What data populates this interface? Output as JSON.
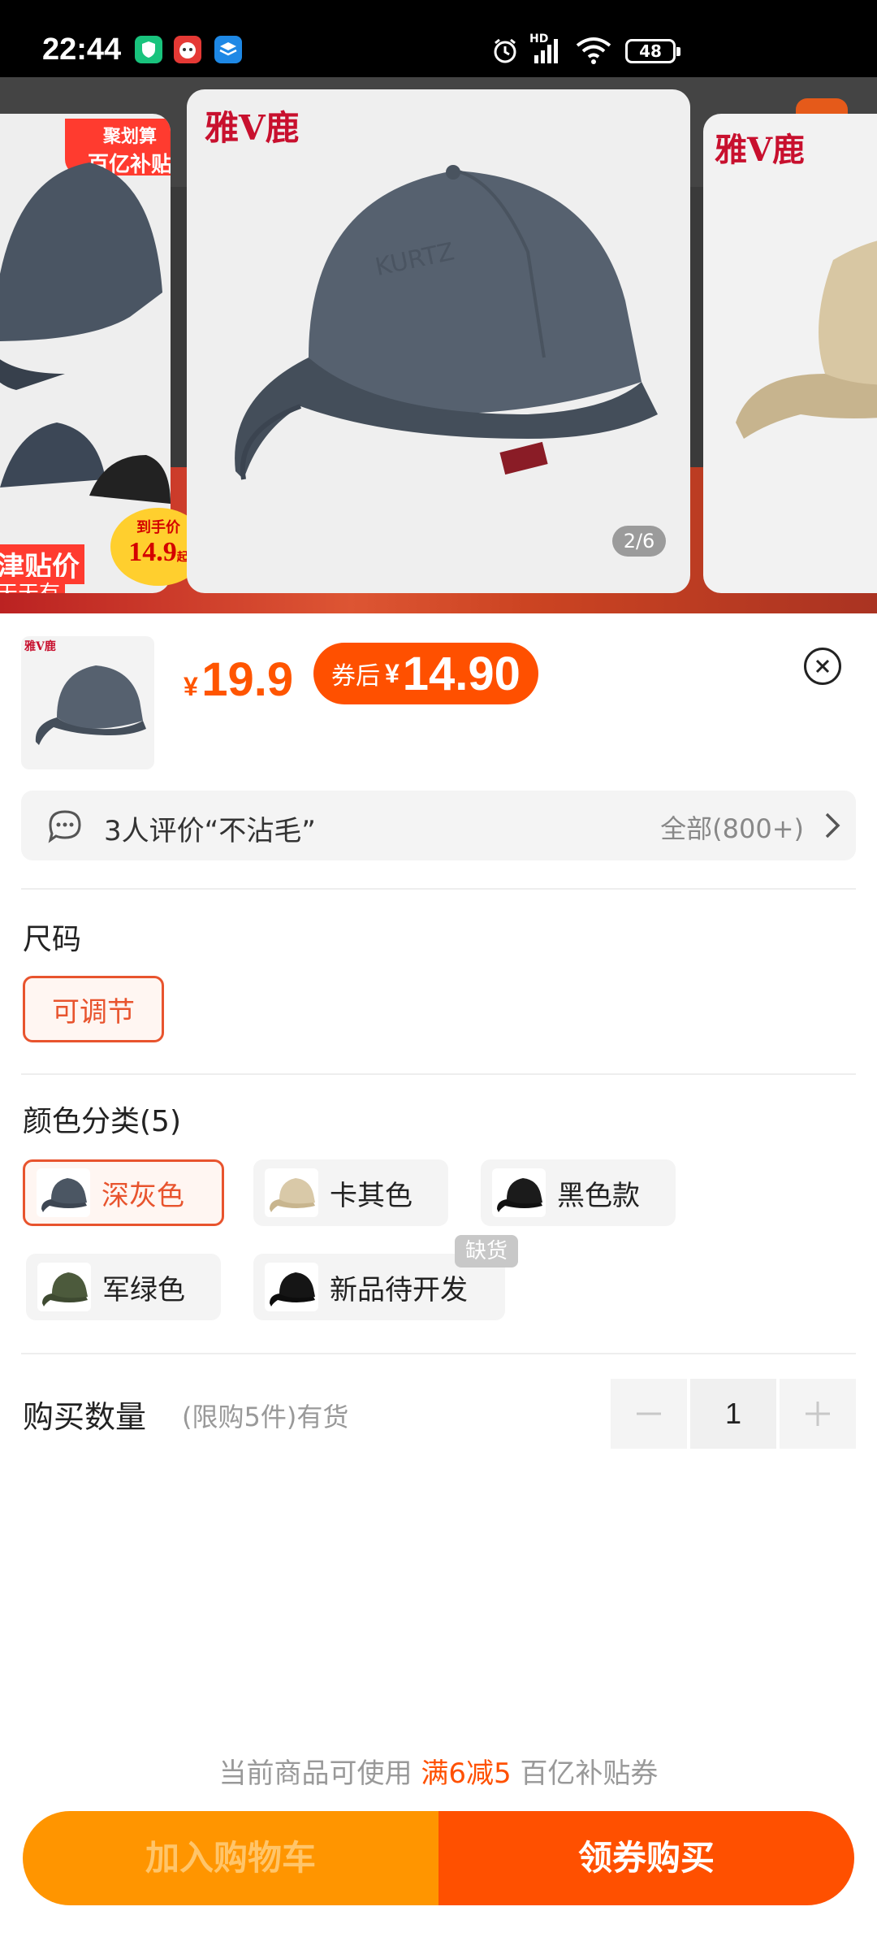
{
  "status_bar": {
    "time": "22:44",
    "signal_label": "HD",
    "battery": "48"
  },
  "gallery": {
    "left_card": {
      "banner_line1": "聚划算",
      "banner_line2": "百亿补贴",
      "price_tag": "到手价",
      "price": "14.9",
      "price_suffix": "起",
      "side_text1": "津贴价",
      "side_text2": "天天有"
    },
    "brand": "雅V鹿",
    "page_indicator": "2/6"
  },
  "sheet": {
    "price": {
      "currency": "¥",
      "value": "19.9"
    },
    "coupon_price": {
      "label": "券后",
      "currency": "¥",
      "value": "14.90"
    },
    "review": {
      "text": "3人评价“不沾毛”",
      "all": "全部(800+)"
    },
    "size": {
      "title": "尺码",
      "options": [
        "可调节"
      ]
    },
    "color": {
      "title": "颜色分类(5)",
      "options": [
        {
          "label": "深灰色",
          "selected": true,
          "cap_color": "#4b5663"
        },
        {
          "label": "卡其色",
          "selected": false,
          "cap_color": "#d9c9a8"
        },
        {
          "label": "黑色款",
          "selected": false,
          "cap_color": "#1b1b1b"
        },
        {
          "label": "军绿色",
          "selected": false,
          "cap_color": "#4c5a3c"
        },
        {
          "label": "新品待开发",
          "selected": false,
          "cap_color": "#151515"
        }
      ],
      "out_of_stock_badge": "缺货"
    },
    "quantity": {
      "label": "购买数量",
      "note": "(限购5件)有货",
      "value": "1",
      "minus": "−",
      "plus": "+"
    },
    "coupon_hint": {
      "prefix": "当前商品可使用",
      "highlight": "满6减5",
      "suffix": "百亿补贴券"
    },
    "buttons": {
      "cart": "加入购物车",
      "buy": "领券购买"
    }
  },
  "colors": {
    "accent": "#ff5000",
    "orange": "#ff9500"
  }
}
